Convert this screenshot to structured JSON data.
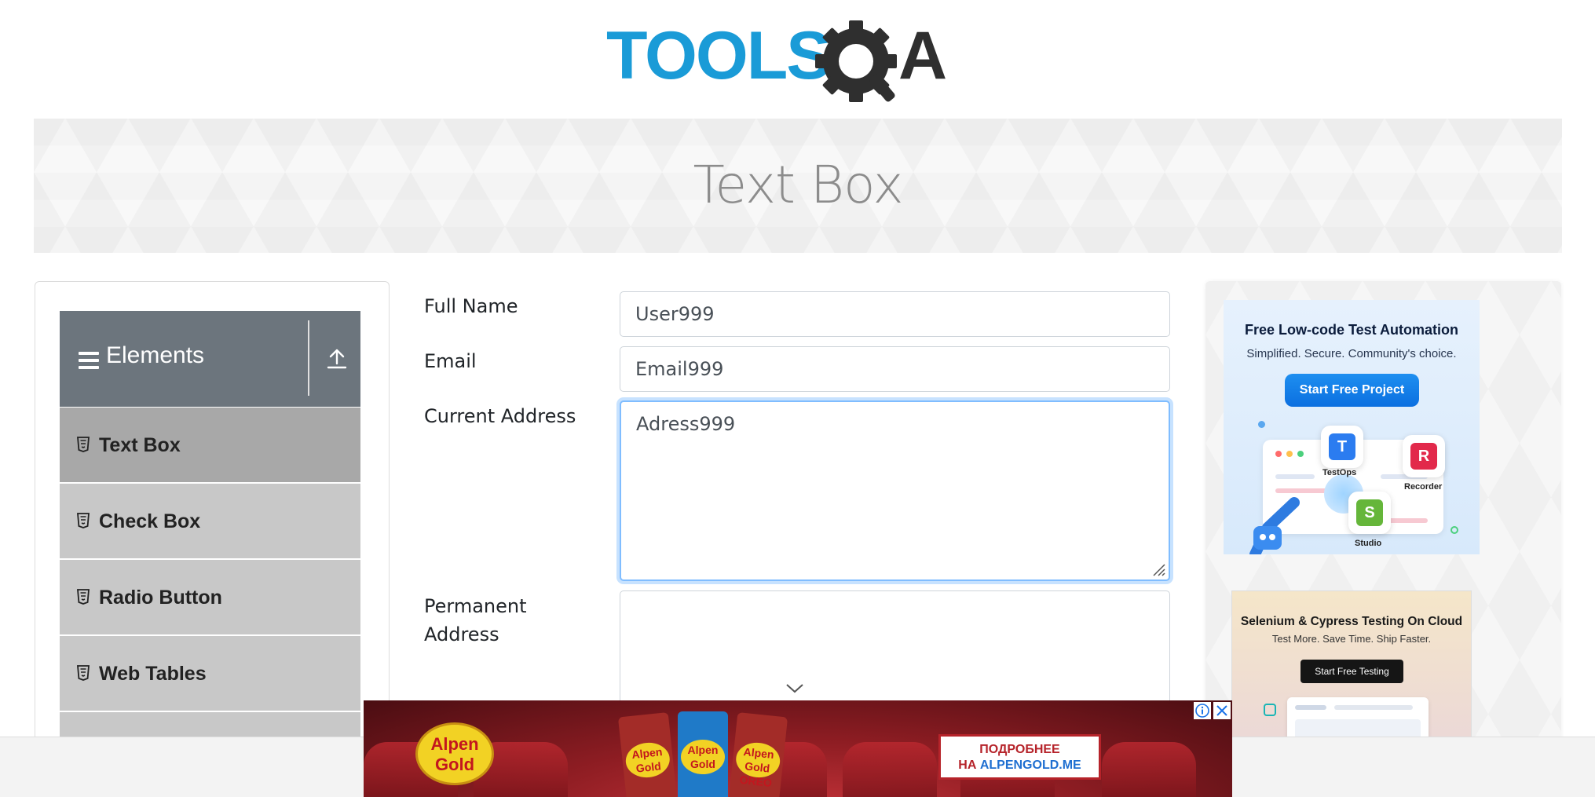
{
  "header": {
    "logo_text": "TOOLSQA"
  },
  "banner": {
    "title": "Text Box"
  },
  "sidebar": {
    "group_title": "Elements",
    "items": [
      {
        "label": "Text Box",
        "active": true
      },
      {
        "label": "Check Box",
        "active": false
      },
      {
        "label": "Radio Button",
        "active": false
      },
      {
        "label": "Web Tables",
        "active": false
      }
    ]
  },
  "form": {
    "full_name": {
      "label": "Full Name",
      "value": "User999"
    },
    "email": {
      "label": "Email",
      "value": "Email999"
    },
    "current_address": {
      "label": "Current Address",
      "value": "Adress999"
    },
    "permanent_address": {
      "label_line1": "Permanent",
      "label_line2": "Address",
      "value": ""
    }
  },
  "ads": {
    "katalon": {
      "headline": "Free Low-code Test Automation",
      "subline": "Simplified. Secure. Community's choice.",
      "button": "Start Free Project",
      "tiles": [
        "TestOps",
        "Recorder",
        "Studio"
      ]
    },
    "lambdatest": {
      "headline": "Selenium & Cypress Testing On Cloud",
      "subline": "Test More. Save Time. Ship Faster.",
      "button": "Start Free Testing"
    },
    "alpengold": {
      "brand_line1": "Alpen",
      "brand_line2": "Gold",
      "bar_labels": [
        "Alpen Gold",
        "Alpen Gold",
        "Alpen Gold OREO"
      ],
      "cta_line1": "ПОДРОБНЕЕ",
      "cta_line2_prefix": "НА ",
      "cta_line2_site": "ALPENGOLD.ME"
    }
  },
  "colors": {
    "logo_blue": "#1a9bd7",
    "logo_dark": "#2f2f2f",
    "sidebar_header": "#6c757d",
    "menu_item": "#c8c8c8",
    "menu_item_active": "#a8a8a8",
    "focus_ring": "#80bdff"
  }
}
